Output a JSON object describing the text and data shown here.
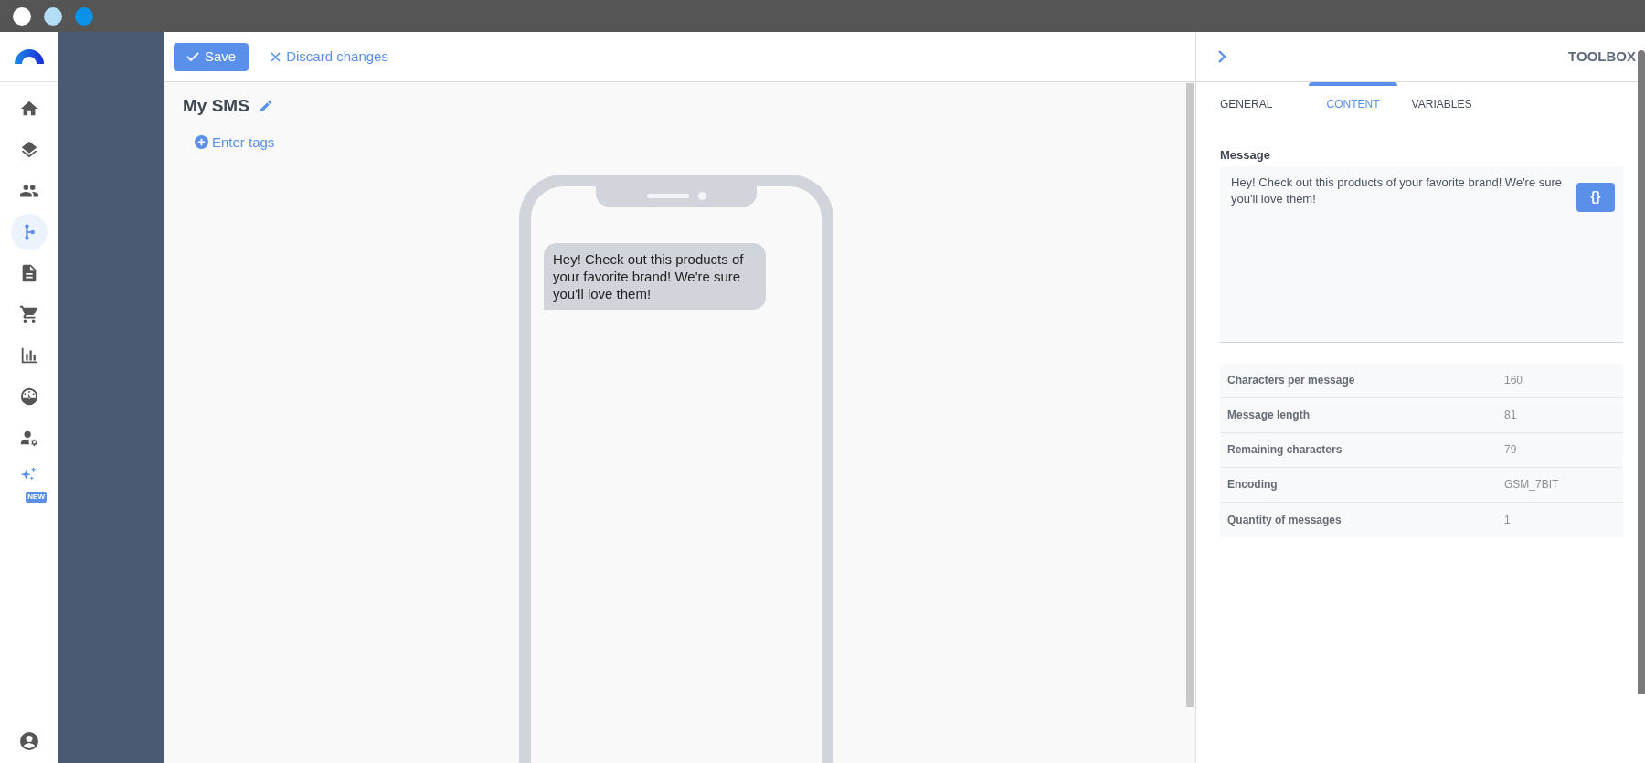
{
  "nav": {
    "items": [
      {
        "selected": false
      },
      {
        "selected": false
      },
      {
        "selected": false
      },
      {
        "selected": true
      },
      {
        "selected": false
      },
      {
        "selected": false
      },
      {
        "selected": false
      },
      {
        "selected": false
      },
      {
        "selected": false
      },
      {
        "selected": false,
        "badge": "NEW"
      }
    ]
  },
  "toolbar": {
    "save": "Save",
    "discard": "Discard changes"
  },
  "editor": {
    "title": "My SMS",
    "tags_link": "Enter tags",
    "preview_message": "Hey! Check out this products of your favorite brand! We're sure you'll love them!"
  },
  "toolbox": {
    "title": "TOOLBOX",
    "tabs": [
      {
        "label": "GENERAL",
        "selected": false
      },
      {
        "label": "CONTENT",
        "selected": true
      },
      {
        "label": "VARIABLES",
        "selected": false
      }
    ],
    "message_label": "Message",
    "message_value": "Hey! Check out this products of your favorite brand! We're sure you'll love them!",
    "variables_button": "{}",
    "stats": [
      {
        "label": "Characters per message",
        "value": "160"
      },
      {
        "label": "Message length",
        "value": "81"
      },
      {
        "label": "Remaining characters",
        "value": "79"
      },
      {
        "label": "Encoding",
        "value": "GSM_7BIT"
      },
      {
        "label": "Quantity of messages",
        "value": "1"
      }
    ]
  }
}
